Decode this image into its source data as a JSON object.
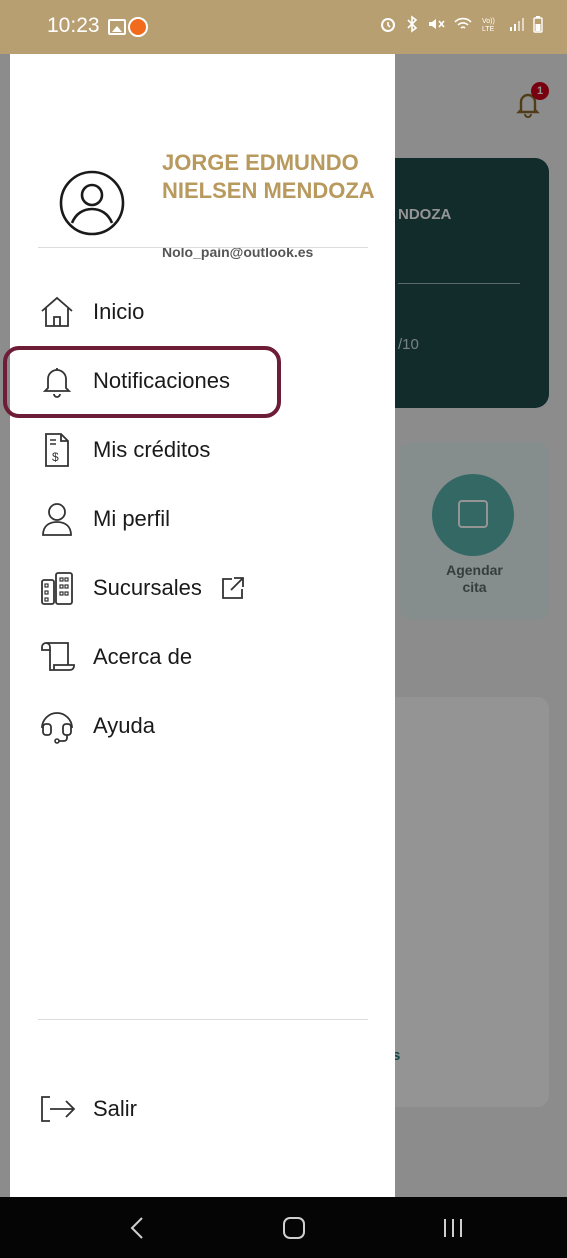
{
  "status_bar": {
    "time": "10:23",
    "right_icons": [
      "alarm-icon",
      "bluetooth-icon",
      "mute-icon",
      "wifi-icon",
      "volte-icon",
      "signal-icon",
      "battery-icon"
    ]
  },
  "background_app": {
    "card_name_fragment": "NDOZA",
    "card_number_fragment": "/10",
    "quick_action": {
      "label": "Agendar\ncita"
    },
    "card_link_fragment": "s",
    "notification_count": "1"
  },
  "drawer": {
    "user": {
      "name": "JORGE EDMUNDO NIELSEN MENDOZA",
      "email": "Nolo_pain@outlook.es"
    },
    "menu": [
      {
        "label": "Inicio",
        "icon": "home-icon"
      },
      {
        "label": "Notificaciones",
        "icon": "bell-icon"
      },
      {
        "label": "Mis créditos",
        "icon": "document-dollar-icon"
      },
      {
        "label": "Mi perfil",
        "icon": "user-icon"
      },
      {
        "label": "Sucursales",
        "icon": "building-icon",
        "trailing_icon": "external-link-icon"
      },
      {
        "label": "Acerca de",
        "icon": "scroll-icon"
      },
      {
        "label": "Ayuda",
        "icon": "headset-icon"
      }
    ],
    "logout": {
      "label": "Salir",
      "icon": "logout-icon"
    }
  },
  "colors": {
    "status_bar": "#b89f72",
    "user_name": "#b89a5e",
    "highlight_border": "#6e1d37",
    "dark_card": "#1f4a4b"
  }
}
